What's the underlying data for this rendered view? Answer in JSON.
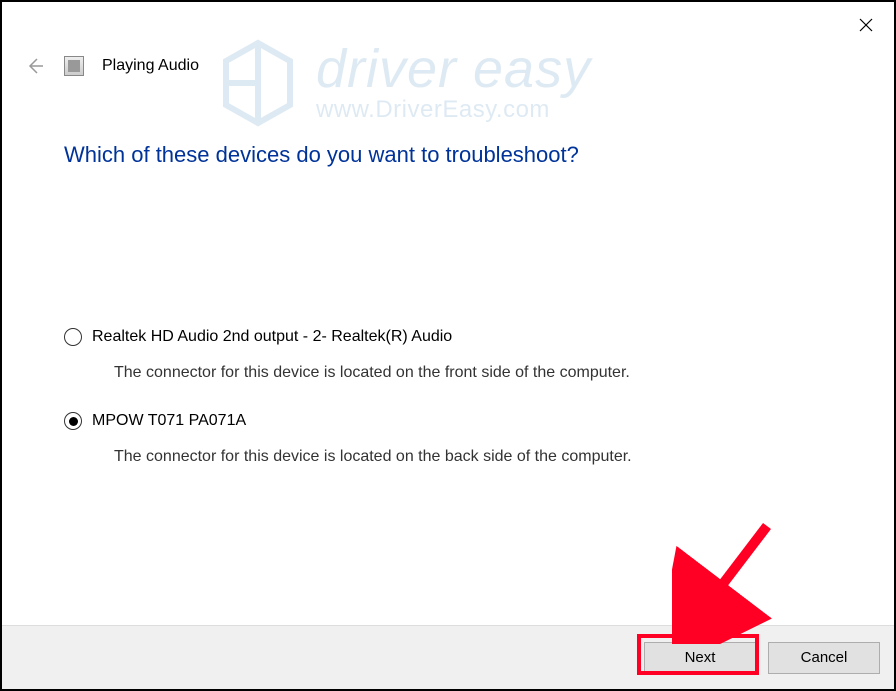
{
  "header": {
    "title": "Playing Audio"
  },
  "content": {
    "question": "Which of these devices do you want to troubleshoot?",
    "options": [
      {
        "label": "Realtek HD Audio 2nd output - 2- Realtek(R) Audio",
        "desc": "The connector for this device is located on the front side of the computer.",
        "selected": false
      },
      {
        "label": "MPOW T071 PA071A",
        "desc": "The connector for this device is located on the back side of the computer.",
        "selected": true
      }
    ]
  },
  "buttons": {
    "next": "Next",
    "cancel": "Cancel"
  },
  "watermark": {
    "brand": "driver easy",
    "url": "www.DriverEasy.com"
  }
}
